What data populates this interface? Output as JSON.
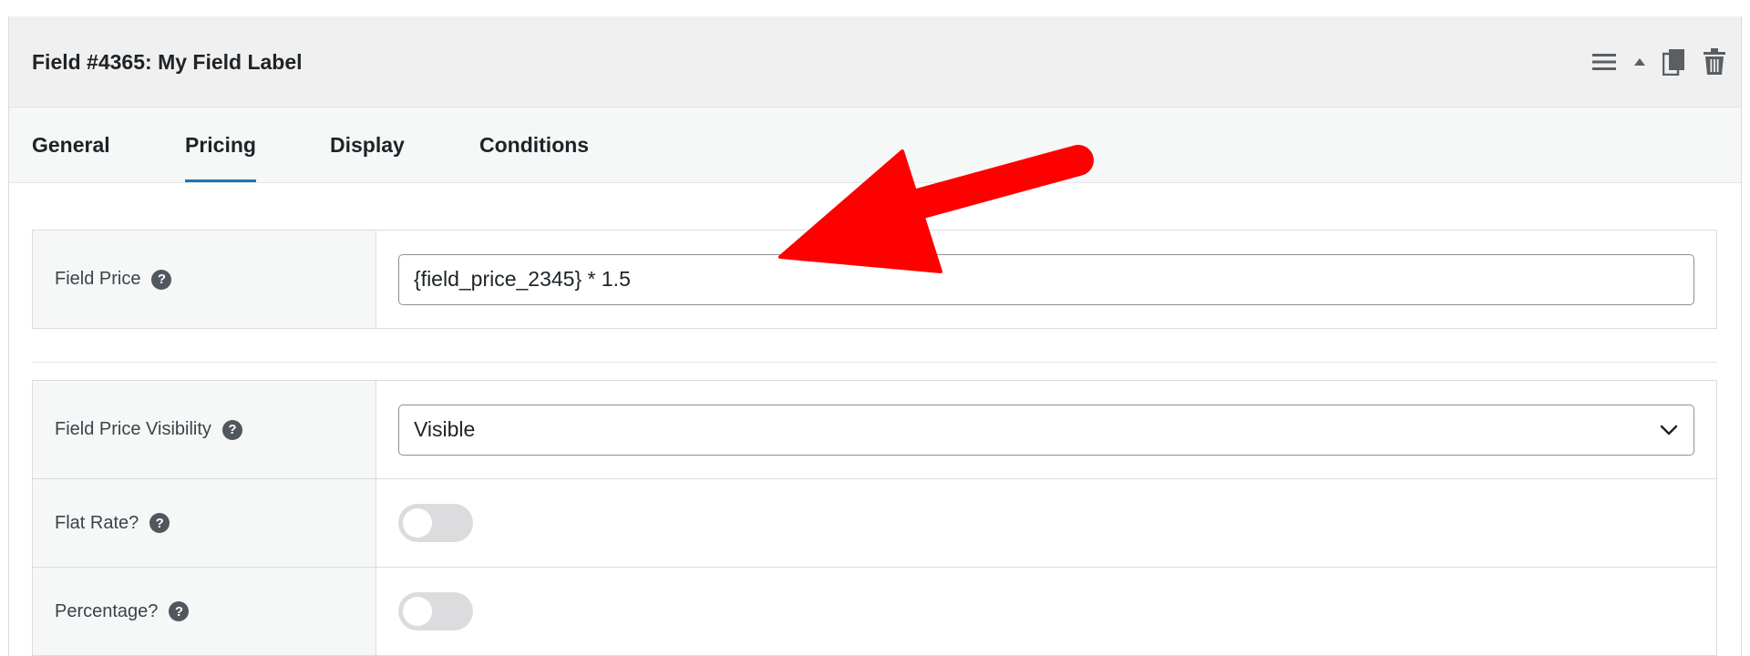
{
  "field_header": {
    "title": "Field #4365: My Field Label",
    "icons": [
      "menu-icon",
      "collapse-arrow-icon",
      "duplicate-icon",
      "trash-icon"
    ]
  },
  "tabs": [
    {
      "label": "General",
      "active": false
    },
    {
      "label": "Pricing",
      "active": true
    },
    {
      "label": "Display",
      "active": false
    },
    {
      "label": "Conditions",
      "active": false
    }
  ],
  "pricing": {
    "field_price": {
      "label": "Field Price",
      "value": "{field_price_2345} * 1.5"
    },
    "visibility": {
      "label": "Field Price Visibility",
      "selected": "Visible"
    },
    "flat_rate": {
      "label": "Flat Rate?",
      "enabled": false
    },
    "percentage": {
      "label": "Percentage?",
      "enabled": false
    }
  },
  "help_glyph": "?",
  "colors": {
    "accent": "#2271b1",
    "annotation": "#ff0000",
    "header_bg": "#f0f0f1",
    "toggle_off": "#dcdcde"
  }
}
